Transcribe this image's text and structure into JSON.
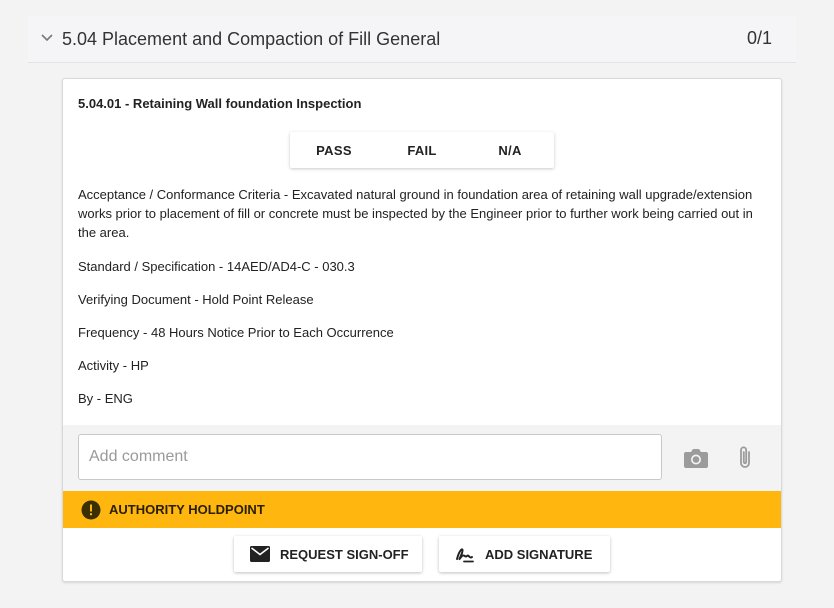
{
  "section": {
    "title": "5.04 Placement and Compaction of Fill General",
    "count": "0/1"
  },
  "item": {
    "title": "5.04.01 - Retaining Wall foundation Inspection",
    "results": [
      "PASS",
      "FAIL",
      "N/A"
    ],
    "acceptance": "Acceptance / Conformance Criteria - Excavated natural ground in foundation area of retaining wall upgrade/extension works prior to placement of fill or concrete must be inspected by the Engineer prior to further work being carried out in the area.",
    "standard": "Standard / Specification - 14AED/AD4-C - 030.3",
    "verifying_document": "Verifying Document - Hold Point Release",
    "frequency": "Frequency - 48 Hours Notice Prior to Each Occurrence",
    "activity": "Activity - HP",
    "by": "By - ENG"
  },
  "comment": {
    "placeholder": "Add comment",
    "value": ""
  },
  "holdpoint": {
    "label": "AUTHORITY HOLDPOINT",
    "color": "#ffb70f"
  },
  "actions": {
    "request_signoff": "REQUEST SIGN-OFF",
    "add_signature": "ADD SIGNATURE"
  },
  "icons": {
    "chevron": "chevron-down-icon",
    "camera": "camera-icon",
    "attachment": "paperclip-icon",
    "warning": "warning-icon",
    "mail": "mail-icon",
    "signature": "signature-icon"
  }
}
